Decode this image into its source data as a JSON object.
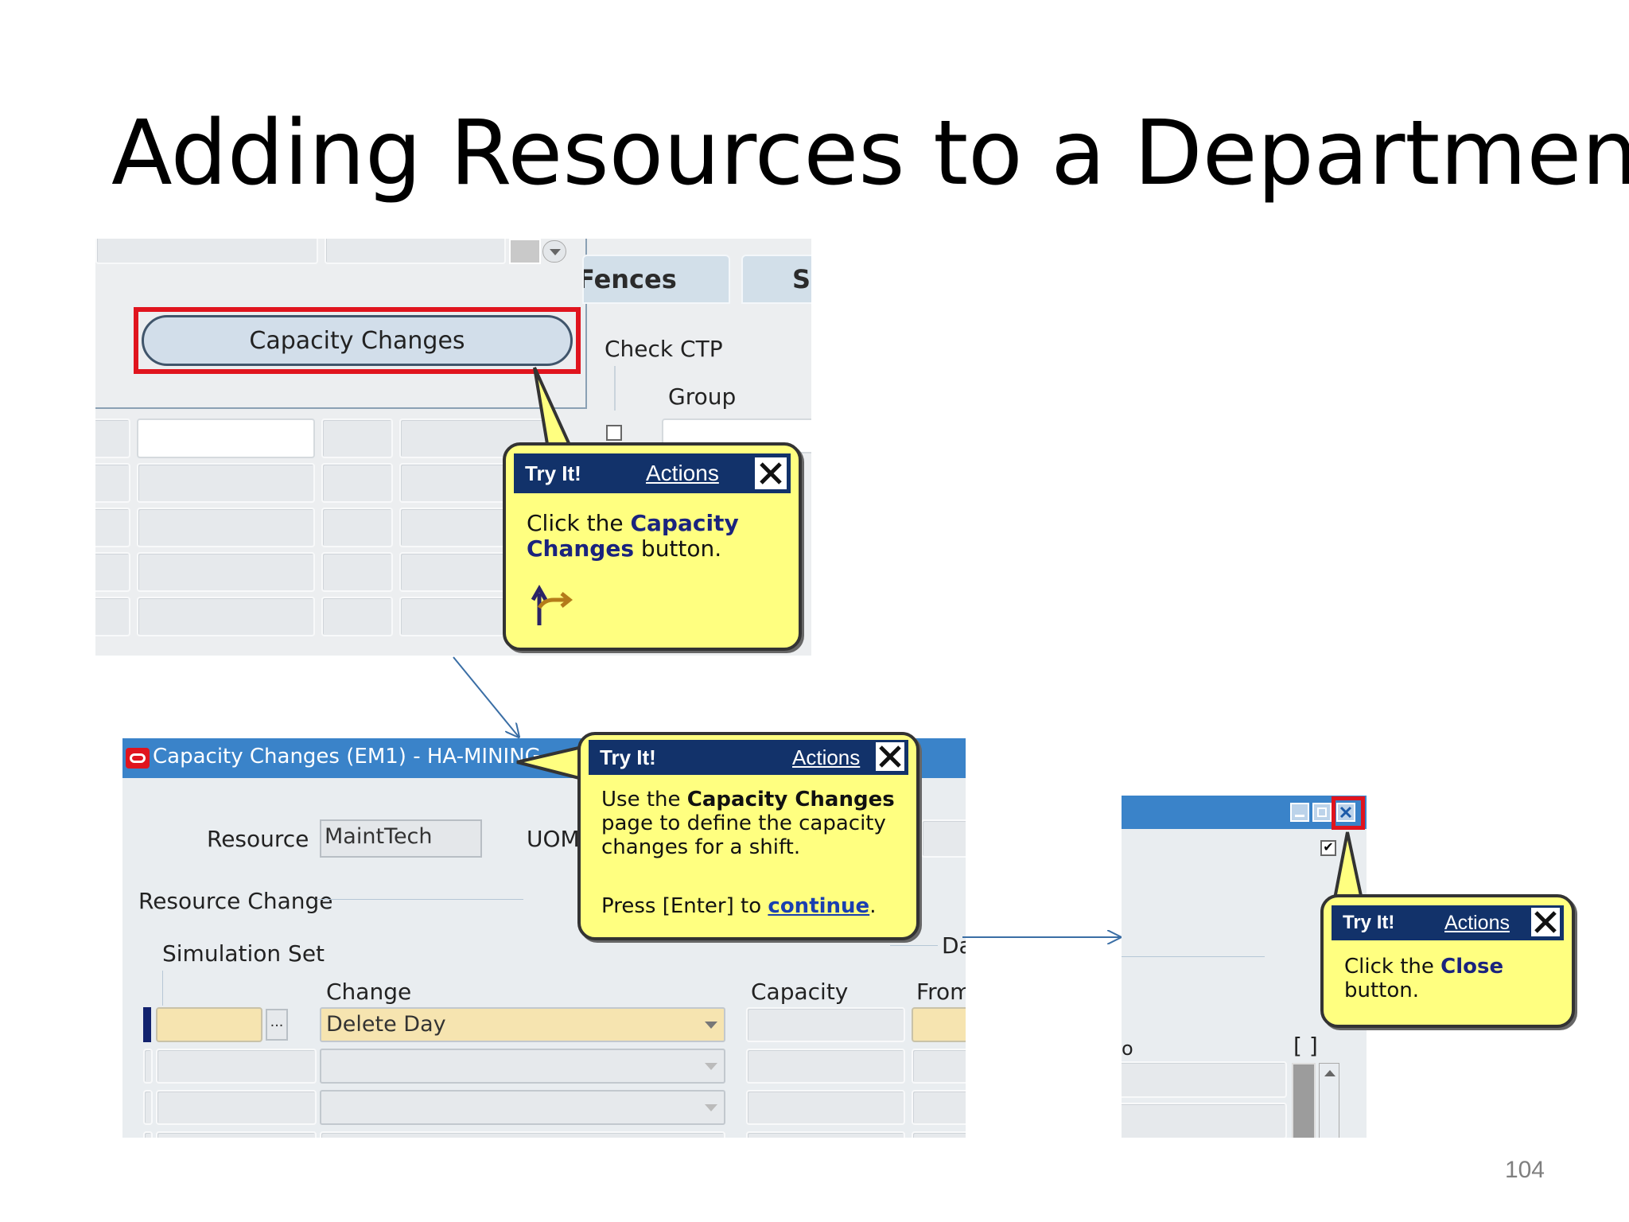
{
  "slide": {
    "title": "Adding Resources to a Department",
    "page_number": "104"
  },
  "screen1": {
    "tabs": [
      "Fences",
      "S"
    ],
    "capacity_button": "Capacity Changes",
    "check_ctp_label": "Check CTP",
    "group_label": "Group"
  },
  "callout1": {
    "header": "Try It!",
    "actions": "Actions",
    "text_before": "Click the ",
    "text_bold": "Capacity Changes",
    "text_after": " button."
  },
  "screen2": {
    "window_title": "Capacity Changes (EM1) - HA-MINING",
    "resource_label": "Resource",
    "resource_value": "MaintTech",
    "uom_label": "UOM",
    "resource_change_label": "Resource Change",
    "simulation_set_label": "Simulation Set",
    "change_label": "Change",
    "capacity_label": "Capacity",
    "from_label": "From",
    "da_label": "Da",
    "change_value": "Delete Day",
    "lov_label": "..."
  },
  "callout2": {
    "header": "Try It!",
    "actions": "Actions",
    "line1_before": "Use the ",
    "line1_bold": "Capacity Changes",
    "line1_after": " page to define the capacity changes for a shift.",
    "line2_before": "Press [Enter] to ",
    "line2_link": "continue",
    "line2_after": "."
  },
  "screen3": {
    "bracket_text": "[ ]",
    "partial_label": "o"
  },
  "callout3": {
    "header": "Try It!",
    "actions": "Actions",
    "text_before": "Click the ",
    "text_bold": "Close",
    "text_after": " button."
  },
  "colors": {
    "callout_fill": "#ffff80",
    "callout_header": "#12326a",
    "highlight": "#e0141e",
    "titlebar": "#3a83c9"
  }
}
